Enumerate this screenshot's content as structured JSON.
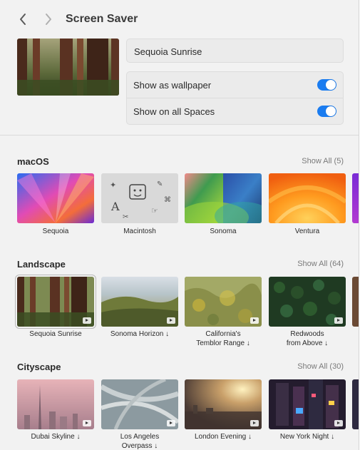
{
  "window": {
    "title": "Screen Saver",
    "nav": {
      "back_icon": "chevron-left-icon",
      "forward_icon": "chevron-right-icon"
    }
  },
  "current": {
    "name": "Sequoia Sunrise",
    "options": [
      {
        "label": "Show as wallpaper",
        "enabled": true
      },
      {
        "label": "Show on all Spaces",
        "enabled": true
      }
    ]
  },
  "accent_color": "#1a7cf0",
  "sections": [
    {
      "title": "macOS",
      "show_all": "Show All (5)",
      "items": [
        {
          "label": "Sequoia",
          "label2": ""
        },
        {
          "label": "Macintosh",
          "label2": ""
        },
        {
          "label": "Sonoma",
          "label2": ""
        },
        {
          "label": "Ventura",
          "label2": ""
        }
      ]
    },
    {
      "title": "Landscape",
      "show_all": "Show All (64)",
      "items": [
        {
          "label": "Sequoia Sunrise",
          "label2": ""
        },
        {
          "label": "Sonoma Horizon ↓",
          "label2": ""
        },
        {
          "label": "California's",
          "label2": "Temblor Range ↓"
        },
        {
          "label": "Redwoods",
          "label2": "from Above ↓"
        }
      ]
    },
    {
      "title": "Cityscape",
      "show_all": "Show All (30)",
      "items": [
        {
          "label": "Dubai Skyline ↓",
          "label2": ""
        },
        {
          "label": "Los Angeles",
          "label2": "Overpass ↓"
        },
        {
          "label": "London Evening ↓",
          "label2": ""
        },
        {
          "label": "New York Night ↓",
          "label2": ""
        }
      ]
    }
  ]
}
